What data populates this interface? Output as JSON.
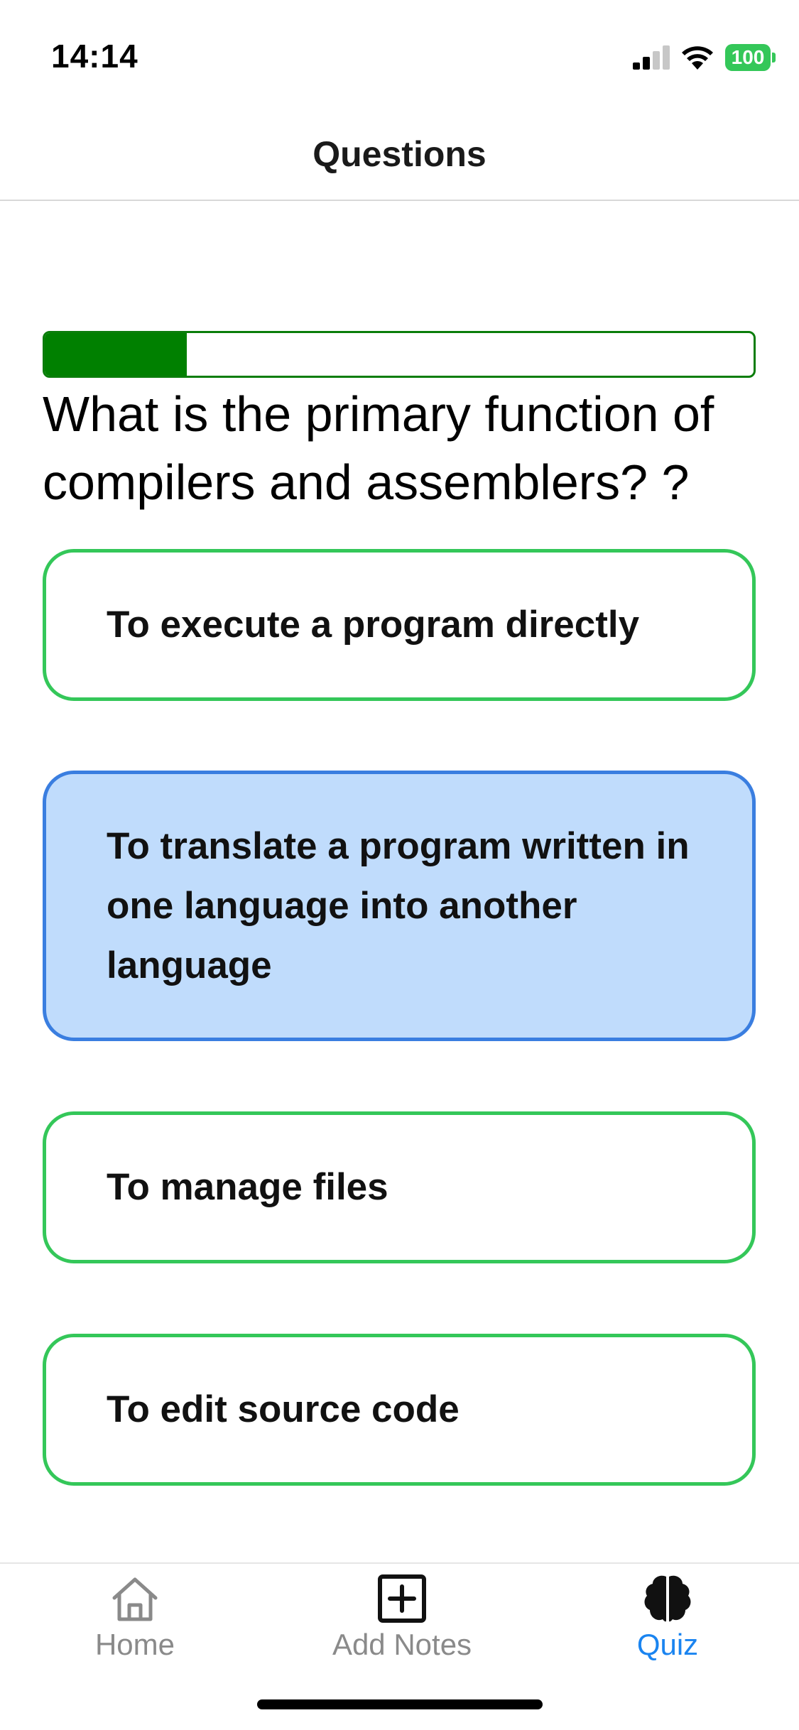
{
  "status_bar": {
    "time": "14:14",
    "battery": "100",
    "icons": [
      "cellular-signal-icon",
      "wifi-icon",
      "battery-icon"
    ]
  },
  "header": {
    "title": "Questions"
  },
  "progress": {
    "fraction": 0.2,
    "fill_color": "#008000"
  },
  "question": {
    "text": "What is the primary function of compilers and assemblers? ?"
  },
  "options": [
    {
      "label": "To execute a program directly",
      "selected": false
    },
    {
      "label": "To translate a program written in one language into another language",
      "selected": true
    },
    {
      "label": "To manage files",
      "selected": false
    },
    {
      "label": "To edit source code",
      "selected": false
    }
  ],
  "colors": {
    "option_border": "#34c759",
    "selected_background": "#c0dcfc",
    "selected_border": "#3a7ee0",
    "active_tab": "#1a84f0",
    "inactive_tab": "#8a8a8a"
  },
  "tab_bar": {
    "tabs": [
      {
        "label": "Home",
        "icon": "home-icon",
        "active": false
      },
      {
        "label": "Add Notes",
        "icon": "plus-square-icon",
        "active": false
      },
      {
        "label": "Quiz",
        "icon": "brain-icon",
        "active": true
      }
    ]
  }
}
